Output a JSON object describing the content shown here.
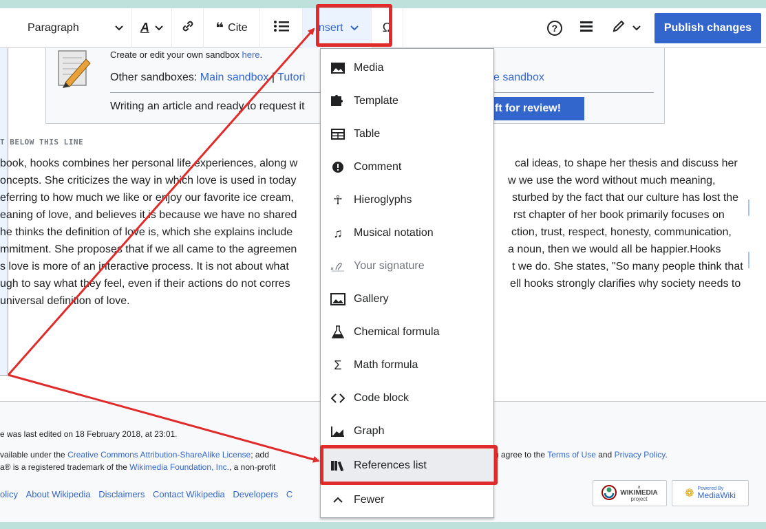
{
  "toolbar": {
    "paragraph_label": "Paragraph",
    "cite_label": "Cite",
    "insert_label": "Insert",
    "omega_label": "Ω",
    "help_label": "?",
    "publish_label": "Publish changes"
  },
  "sandbox": {
    "line1_prefix": "Create or edit your own sandbox ",
    "line1_link": "here",
    "line1_suffix": ".",
    "line2_prefix": "Other sandboxes: ",
    "main_sandbox": "Main sandbox",
    "separator": " | ",
    "tutorial_partial": "Tutori",
    "sandbox_partial": "e sandbox",
    "line3": "Writing an article and ready to request it",
    "review_button": "ft for review!"
  },
  "below_line": "T BELOW THIS LINE",
  "article_lines": [
    {
      "left": "book, hooks combines her personal life experiences, along w",
      "right": "cal ideas, to shape her thesis and discuss her"
    },
    {
      "left": "oncepts. She criticizes the way in which love is used in today",
      "right": "w we use the word without much meaning,"
    },
    {
      "left": "eferring to how much we like or enjoy our favorite ice cream,",
      "right": "sturbed by the fact that our culture has lost the"
    },
    {
      "left": "eaning of love, and believes it is because we have no shared",
      "right": "rst chapter of her book primarily focuses on"
    },
    {
      "left": "he thinks the definition of love is, which she explains include",
      "right": "ction, trust, respect, honesty, communication,"
    },
    {
      "left": "mmitment. She proposes that if we all came to the agreemen",
      "right": "a noun, then we would all be happier.Hooks"
    },
    {
      "left": "s love is more of an interactive process. It is not about what",
      "right": "t we do. She states, \"So many people think that"
    },
    {
      "left": "ugh to say what they feel, even if their actions do not corres",
      "right": "ell hooks strongly clarifies why society needs to"
    },
    {
      "left": "universal definition of love.",
      "right": ""
    }
  ],
  "footer": {
    "last_edited": "e was last edited on 18 February 2018, at 23:01.",
    "license_prefix": "vailable under the ",
    "license_link": "Creative Commons Attribution-ShareAlike License",
    "license_mid": "; add",
    "license_right_prefix": "u agree to the ",
    "terms_link": "Terms of Use",
    "and": " and ",
    "privacy_link": "Privacy Policy",
    "period": ".",
    "trademark_prefix": "a® is a registered trademark of the ",
    "wmf_link": "Wikimedia Foundation, Inc.",
    "trademark_suffix": ", a non-profit",
    "links": [
      "olicy",
      "About Wikipedia",
      "Disclaimers",
      "Contact Wikipedia",
      "Developers",
      "C"
    ],
    "wikimedia_logo": "WIKIMEDIA",
    "wikimedia_sub": "project",
    "wikimedia_a": "a",
    "mediawiki_top": "Powered By",
    "mediawiki_logo": "MediaWiki"
  },
  "insert_menu": {
    "items": [
      {
        "label": "Media",
        "icon": "image-icon"
      },
      {
        "label": "Template",
        "icon": "puzzle-icon"
      },
      {
        "label": "Table",
        "icon": "table-icon"
      },
      {
        "label": "Comment",
        "icon": "comment-icon"
      },
      {
        "label": "Hieroglyphs",
        "icon": "ankh-icon"
      },
      {
        "label": "Musical notation",
        "icon": "music-icon"
      },
      {
        "label": "Your signature",
        "icon": "signature-icon"
      },
      {
        "label": "Gallery",
        "icon": "gallery-icon"
      },
      {
        "label": "Chemical formula",
        "icon": "flask-icon"
      },
      {
        "label": "Math formula",
        "icon": "sigma-icon"
      },
      {
        "label": "Code block",
        "icon": "code-icon"
      },
      {
        "label": "Graph",
        "icon": "graph-icon"
      },
      {
        "label": "References list",
        "icon": "books-icon"
      },
      {
        "label": "Fewer",
        "icon": "chevron-up-icon"
      }
    ]
  },
  "colors": {
    "accent": "#3366cc",
    "highlight": "#e02b2b",
    "strip": "#bfe1dc"
  }
}
